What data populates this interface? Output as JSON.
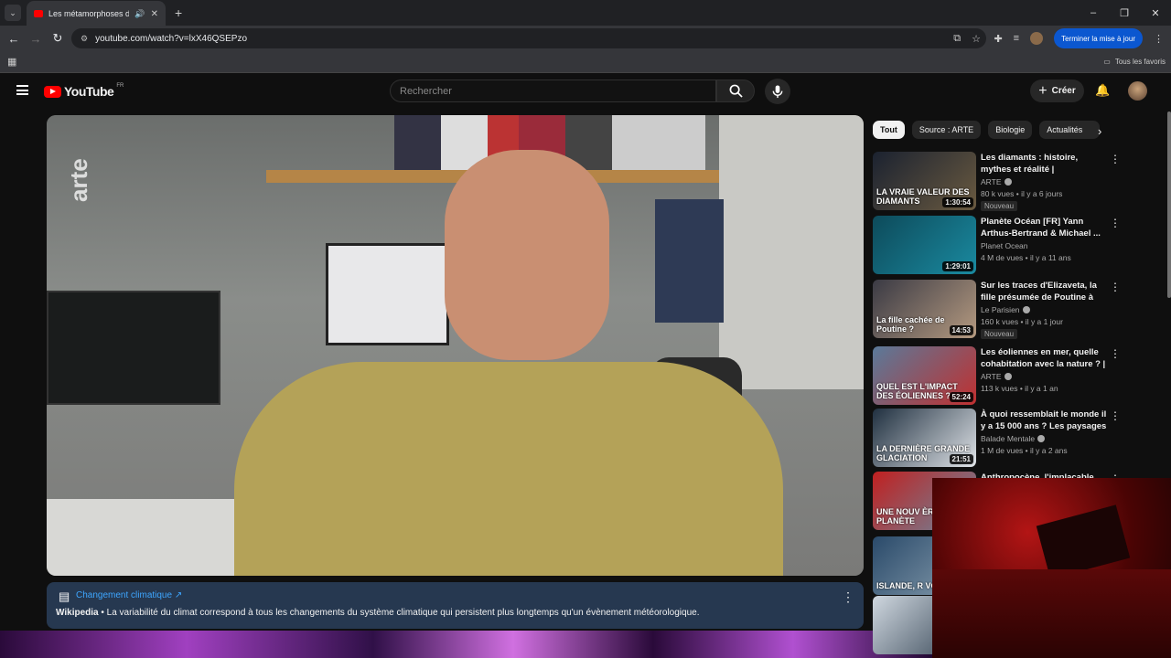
{
  "browser": {
    "tab_title": "Les métamorphoses des gla",
    "url": "youtube.com/watch?v=lxX46QSEPzo",
    "update_button": "Terminer la mise à jour",
    "bookmarks_all": "Tous les favoris"
  },
  "youtube": {
    "logo": "YouTube",
    "region": "FR",
    "search_placeholder": "Rechercher",
    "create": "Créer"
  },
  "video": {
    "watermark": "arte"
  },
  "info_panel": {
    "title": "Changement climatique",
    "source": "Wikipedia",
    "description": " • La variabilité du climat correspond à tous les changements du système climatique qui persistent plus longtemps qu'un évènement météorologique."
  },
  "chips": [
    "Tout",
    "Source : ARTE",
    "Biologie",
    "Actualités"
  ],
  "recommendations": [
    {
      "title": "Les diamants : histoire, mythes et réalité | Documentaire | ARTE",
      "channel": "ARTE",
      "verified": true,
      "meta": "80 k vues • il y a 6 jours",
      "badge": "Nouveau",
      "duration": "1:30:54",
      "thumb_text": "LA VRAIE VALEUR DES DIAMANTS",
      "color1": "#1b2230",
      "color2": "#6a5a40"
    },
    {
      "title": "Planète Océan [FR] Yann Arthus-Bertrand & Michael ...",
      "channel": "Planet Ocean",
      "verified": false,
      "meta": "4 M de vues • il y a 11 ans",
      "badge": "",
      "duration": "1:29:01",
      "thumb_text": "",
      "color1": "#0d4a5a",
      "color2": "#1a8aa0"
    },
    {
      "title": "Sur les traces d'Elizaveta, la fille présumée de Poutine à Paris",
      "channel": "Le Parisien",
      "verified": true,
      "meta": "160 k vues • il y a 1 jour",
      "badge": "Nouveau",
      "duration": "14:53",
      "thumb_text": "La fille cachée de Poutine ?",
      "color1": "#3a3a44",
      "color2": "#b59a80"
    },
    {
      "title": "Les éoliennes en mer, quelle cohabitation avec la nature ? | ...",
      "channel": "ARTE",
      "verified": true,
      "meta": "113 k vues • il y a 1 an",
      "badge": "",
      "duration": "52:24",
      "thumb_text": "QUEL EST L'IMPACT DES ÉOLIENNES ?",
      "color1": "#5a7a9a",
      "color2": "#c03030"
    },
    {
      "title": "À quoi ressemblait le monde il y a 15 000 ans ? Les paysages ...",
      "channel": "Balade Mentale",
      "verified": true,
      "meta": "1 M de vues • il y a 2 ans",
      "badge": "",
      "duration": "21:51",
      "thumb_text": "LA DERNIÈRE GRANDE GLACIATION",
      "color1": "#203040",
      "color2": "#e0e4e8"
    },
    {
      "title": "Anthropocène, l'implacable...",
      "channel": "",
      "verified": false,
      "meta": "",
      "badge": "",
      "duration": "",
      "thumb_text": "UNE NOUV ÈRE POUR PLANÈTE",
      "color1": "#c02020",
      "color2": "#6a8aa0"
    },
    {
      "title": "",
      "channel": "",
      "verified": false,
      "meta": "",
      "badge": "",
      "duration": "",
      "thumb_text": "ISLANDE, R VOYAG",
      "color1": "#2a4a6a",
      "color2": "#8aa0b0"
    },
    {
      "title": "",
      "channel": "",
      "verified": false,
      "meta": "",
      "badge": "",
      "duration": "",
      "thumb_text": "",
      "color1": "#d0d8e0",
      "color2": "#304050"
    }
  ]
}
